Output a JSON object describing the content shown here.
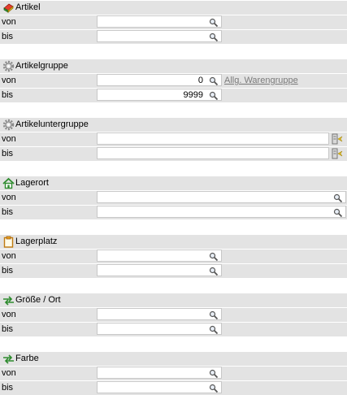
{
  "sections": {
    "artikel": {
      "title": "Artikel",
      "icon": "article-icon",
      "von": {
        "label": "von",
        "value": ""
      },
      "bis": {
        "label": "bis",
        "value": ""
      }
    },
    "artikelgruppe": {
      "title": "Artikelgruppe",
      "icon": "gear-icon",
      "von": {
        "label": "von",
        "value": "0"
      },
      "bis": {
        "label": "bis",
        "value": "9999"
      },
      "link": "Allg. Warengruppe"
    },
    "artikeluntergruppe": {
      "title": "Artikeluntergruppe",
      "icon": "gear-icon",
      "von": {
        "label": "von",
        "value": ""
      },
      "bis": {
        "label": "bis",
        "value": ""
      }
    },
    "lagerort": {
      "title": "Lagerort",
      "icon": "house-icon",
      "von": {
        "label": "von",
        "value": ""
      },
      "bis": {
        "label": "bis",
        "value": ""
      }
    },
    "lagerplatz": {
      "title": "Lagerplatz",
      "icon": "clipboard-icon",
      "von": {
        "label": "von",
        "value": ""
      },
      "bis": {
        "label": "bis",
        "value": ""
      }
    },
    "groesse": {
      "title": "Größe / Ort",
      "icon": "arrows-icon",
      "von": {
        "label": "von",
        "value": ""
      },
      "bis": {
        "label": "bis",
        "value": ""
      }
    },
    "farbe": {
      "title": "Farbe",
      "icon": "arrows-icon",
      "von": {
        "label": "von",
        "value": ""
      },
      "bis": {
        "label": "bis",
        "value": ""
      }
    }
  }
}
